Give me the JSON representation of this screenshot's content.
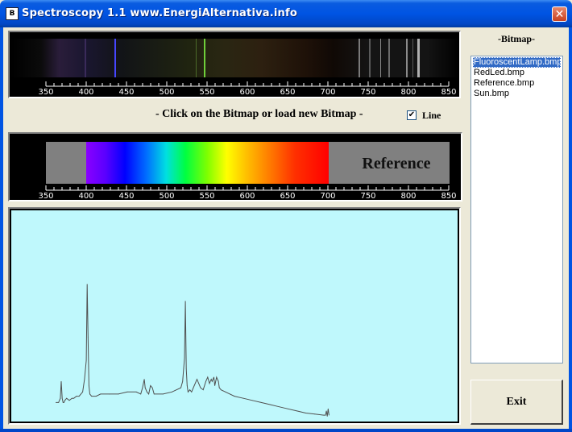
{
  "window": {
    "title": "Spectroscopy 1.1 www.EnergiAlternativa.info",
    "icon_label": "B",
    "close_label": "✕"
  },
  "spectrum_bitmap": {
    "description_icon": "fluorescent-spectrum",
    "scale_labels": [
      "350",
      "400",
      "450",
      "500",
      "550",
      "600",
      "650",
      "700",
      "750",
      "800",
      "850"
    ]
  },
  "hint_text": "- Click on the Bitmap or load new Bitmap -",
  "line_checkbox": {
    "label": "Line",
    "checked": true,
    "check_glyph": "✔"
  },
  "reference_bitmap": {
    "label": "Reference",
    "scale_labels": [
      "350",
      "400",
      "450",
      "500",
      "550",
      "600",
      "650",
      "700",
      "750",
      "800",
      "850"
    ]
  },
  "bitmap_panel": {
    "title": "-Bitmap-",
    "files": [
      "FluoroscentLamp.bmp",
      "RedLed.bmp",
      "Reference.bmp",
      "Sun.bmp"
    ],
    "selected_index": 0
  },
  "exit_button": {
    "label": "Exit"
  },
  "chart_data": {
    "type": "line",
    "title": "",
    "xlabel": "",
    "ylabel": "",
    "xlim": [
      350,
      850
    ],
    "ylim": [
      0,
      1
    ],
    "grid": false,
    "series": [
      {
        "x": [
          400,
          403,
          405,
          406,
          407,
          408,
          409,
          410,
          412,
          415,
          418,
          420,
          423,
          426,
          430,
          432,
          434,
          435,
          436,
          437,
          438,
          440,
          445,
          450,
          460,
          470,
          480,
          490,
          495,
          497,
          499,
          500,
          502,
          504,
          506,
          508,
          510,
          520,
          530,
          535,
          540,
          542,
          544,
          545,
          546,
          547,
          548,
          550,
          552,
          555,
          558,
          560,
          562,
          565,
          568,
          570,
          572,
          574,
          575,
          577,
          578,
          580,
          582,
          583,
          585,
          590,
          600,
          610,
          620,
          630,
          640,
          650,
          660,
          670,
          680,
          690,
          700,
          702,
          703,
          704,
          705,
          706
        ],
        "values": [
          0.09,
          0.09,
          0.11,
          0.19,
          0.11,
          0.09,
          0.09,
          0.1,
          0.11,
          0.1,
          0.11,
          0.11,
          0.12,
          0.12,
          0.14,
          0.2,
          0.29,
          0.65,
          0.4,
          0.17,
          0.13,
          0.12,
          0.12,
          0.13,
          0.13,
          0.13,
          0.14,
          0.14,
          0.13,
          0.16,
          0.2,
          0.16,
          0.14,
          0.13,
          0.17,
          0.16,
          0.13,
          0.13,
          0.14,
          0.15,
          0.16,
          0.19,
          0.3,
          0.57,
          0.25,
          0.17,
          0.14,
          0.15,
          0.14,
          0.17,
          0.2,
          0.18,
          0.16,
          0.15,
          0.19,
          0.21,
          0.18,
          0.2,
          0.19,
          0.21,
          0.17,
          0.21,
          0.19,
          0.16,
          0.15,
          0.14,
          0.12,
          0.11,
          0.1,
          0.09,
          0.08,
          0.07,
          0.06,
          0.05,
          0.04,
          0.035,
          0.03,
          0.03,
          0.05,
          0.025,
          0.06,
          0.03
        ]
      }
    ]
  },
  "colors": {
    "graph_bg": "#bff8fc",
    "line": "#505050",
    "selection": "#316ac5"
  }
}
